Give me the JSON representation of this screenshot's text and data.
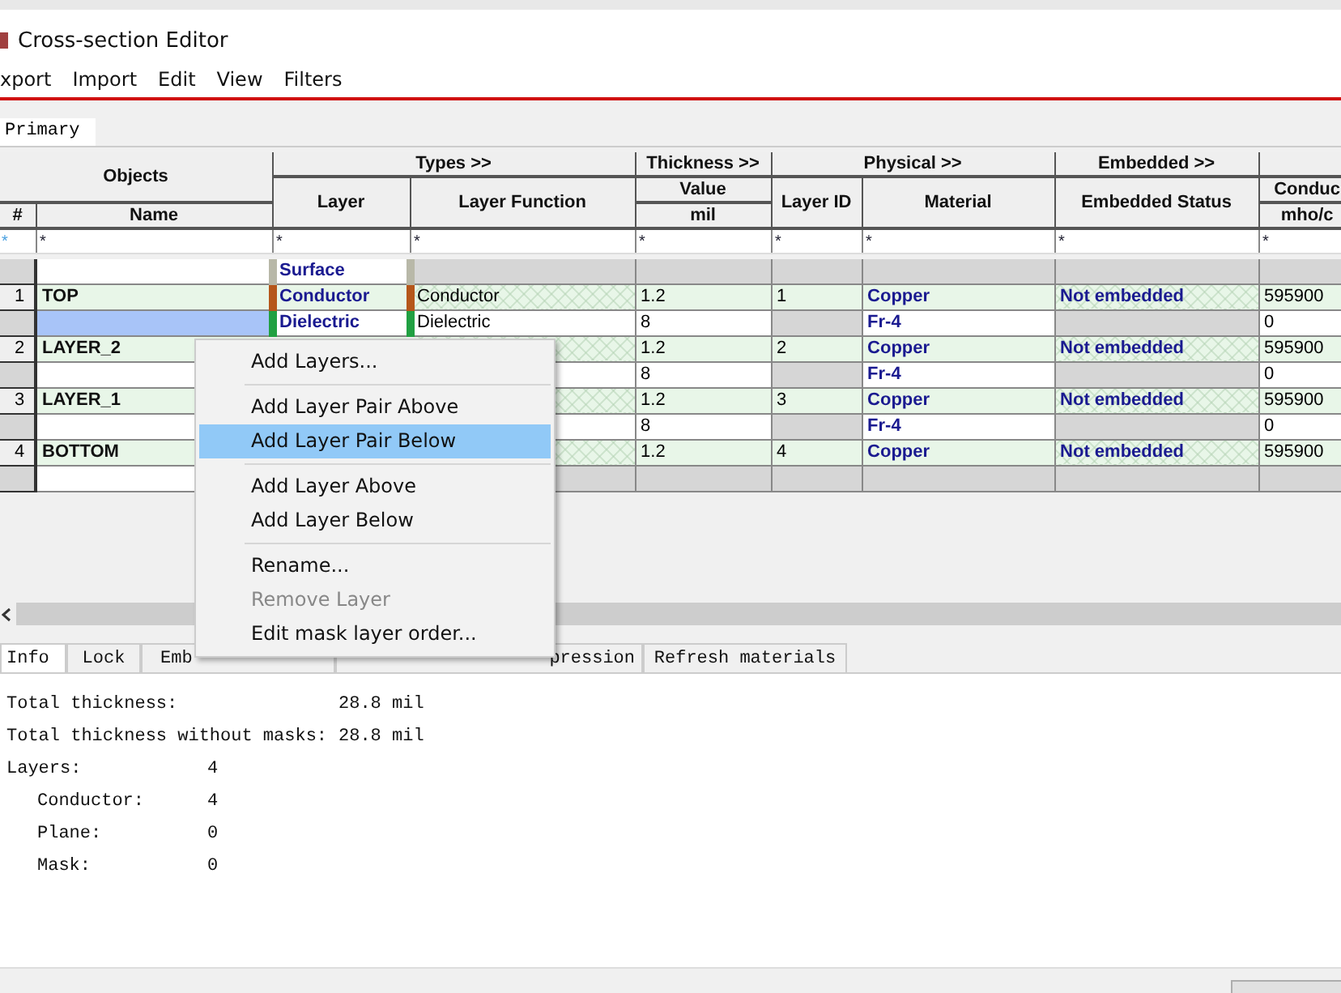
{
  "window": {
    "title": "Cross-section Editor"
  },
  "menu_bar": [
    "xport",
    "Import",
    "Edit",
    "View",
    "Filters"
  ],
  "view_tabs": [
    {
      "label": "Primary",
      "selected": true
    }
  ],
  "table": {
    "groups": [
      {
        "kind": "stacked",
        "label": "Objects",
        "columns": [
          {
            "label": "#"
          },
          {
            "label": "Name"
          }
        ]
      },
      {
        "kind": "normal",
        "label": "Types >>",
        "columns": [
          {
            "label": "Layer"
          },
          {
            "label": "Layer Function"
          }
        ]
      },
      {
        "kind": "normal",
        "label": "Thickness >>",
        "columns": [
          {
            "label": "Value",
            "unit": "mil"
          }
        ]
      },
      {
        "kind": "normal",
        "label": "Physical >>",
        "columns": [
          {
            "label": "Layer ID"
          },
          {
            "label": "Material"
          }
        ]
      },
      {
        "kind": "normal",
        "label": "Embedded >>",
        "columns": [
          {
            "label": "Embedded Status"
          }
        ]
      },
      {
        "kind": "normal",
        "columns": [
          {
            "label": "Conduc",
            "unit": "mho/c"
          }
        ]
      }
    ],
    "filters": [
      "*",
      "*",
      "*",
      "*",
      "*",
      "*",
      "*",
      "*",
      "*"
    ],
    "rows": [
      {
        "kind": "surface",
        "selected": false,
        "layer": "Surface"
      },
      {
        "kind": "conductor",
        "selected": false,
        "num": "1",
        "name": "TOP",
        "layer": "Conductor",
        "function": "Conductor",
        "thickness": "1.2",
        "layer_id": "1",
        "material": "Copper",
        "embedded": "Not embedded",
        "conductivity": "595900"
      },
      {
        "kind": "dielectric",
        "selected": true,
        "layer": "Dielectric",
        "function": "Dielectric",
        "thickness": "8",
        "material": "Fr-4",
        "conductivity": "0"
      },
      {
        "kind": "conductor",
        "selected": false,
        "num": "2",
        "name": "LAYER_2",
        "thickness": "1.2",
        "layer_id": "2",
        "material": "Copper",
        "embedded": "Not embedded",
        "conductivity": "595900"
      },
      {
        "kind": "dielectric",
        "selected": false,
        "thickness": "8",
        "material": "Fr-4",
        "conductivity": "0"
      },
      {
        "kind": "conductor",
        "selected": false,
        "num": "3",
        "name": "LAYER_1",
        "thickness": "1.2",
        "layer_id": "3",
        "material": "Copper",
        "embedded": "Not embedded",
        "conductivity": "595900"
      },
      {
        "kind": "dielectric",
        "selected": false,
        "thickness": "8",
        "material": "Fr-4",
        "conductivity": "0"
      },
      {
        "kind": "conductor",
        "selected": false,
        "num": "4",
        "name": "BOTTOM",
        "thickness": "1.2",
        "layer_id": "4",
        "material": "Copper",
        "embedded": "Not embedded",
        "conductivity": "595900"
      },
      {
        "kind": "surface",
        "selected": false
      }
    ]
  },
  "context_menu": [
    {
      "kind": "item",
      "label": "Add Layers...",
      "disabled": false,
      "selected": false
    },
    {
      "kind": "separator"
    },
    {
      "kind": "item",
      "label": "Add Layer Pair Above",
      "disabled": false,
      "selected": false
    },
    {
      "kind": "item",
      "label": "Add Layer Pair Below",
      "disabled": false,
      "selected": true
    },
    {
      "kind": "separator"
    },
    {
      "kind": "item",
      "label": "Add Layer Above",
      "disabled": false,
      "selected": false
    },
    {
      "kind": "item",
      "label": "Add Layer Below",
      "disabled": false,
      "selected": false
    },
    {
      "kind": "separator"
    },
    {
      "kind": "item",
      "label": "Rename...",
      "disabled": false,
      "selected": false
    },
    {
      "kind": "item",
      "label": "Remove Layer",
      "disabled": true,
      "selected": false
    },
    {
      "kind": "item",
      "label": "Edit mask layer order...",
      "disabled": false,
      "selected": false
    }
  ],
  "bottom_tabs": [
    {
      "label": "Info",
      "selected": true
    },
    {
      "label": "Lock",
      "selected": false
    },
    {
      "label": "Emb",
      "selected": false
    },
    {
      "label": "pression",
      "selected": false
    },
    {
      "label": "Refresh materials",
      "selected": false
    }
  ],
  "info": [
    {
      "label": "Total thickness:",
      "value": "28.8 mil"
    },
    {
      "label": "Total thickness without masks:",
      "value": "28.8 mil"
    },
    {
      "label": "Layers:",
      "value": "4",
      "children": [
        {
          "label": "Conductor:",
          "value": "4"
        },
        {
          "label": "Plane:",
          "value": "0"
        },
        {
          "label": "Mask:",
          "value": "0"
        }
      ]
    }
  ]
}
